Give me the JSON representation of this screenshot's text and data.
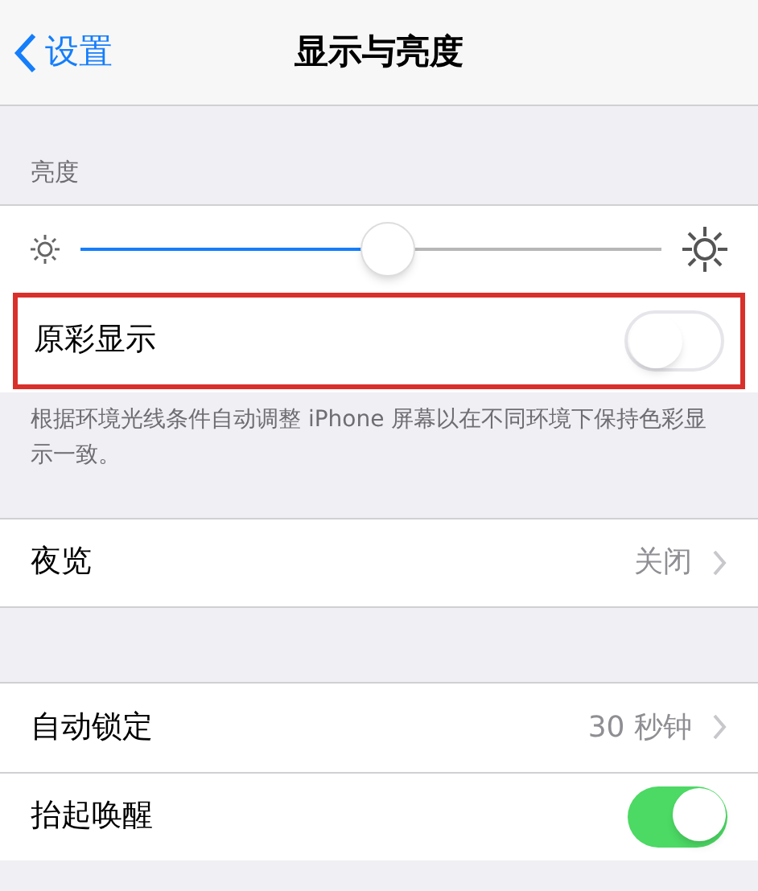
{
  "nav_bar": {
    "back_label": "设置",
    "title": "显示与亮度"
  },
  "brightness_section": {
    "header": "亮度",
    "slider": {
      "level": 0.53
    }
  },
  "true_tone": {
    "label": "原彩显示",
    "on": false,
    "highlighted": true,
    "footer": "根据环境光线条件自动调整 iPhone 屏幕以在不同环境下保持色彩显示一致。"
  },
  "night_shift": {
    "label": "夜览",
    "value": "关闭"
  },
  "lock_section": [
    {
      "kind": "value",
      "label": "自动锁定",
      "value": "30 秒钟"
    },
    {
      "kind": "toggle",
      "label": "抬起唤醒",
      "on": true
    }
  ]
}
